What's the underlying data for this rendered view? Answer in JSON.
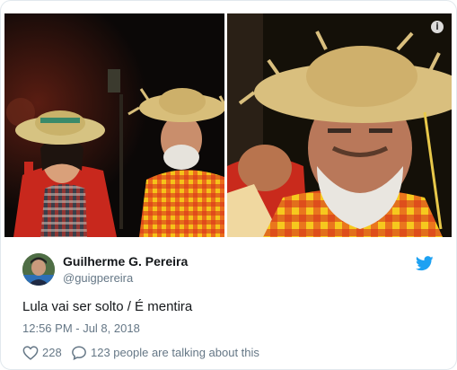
{
  "tweet": {
    "display_name": "Guilherme G. Pereira",
    "handle": "@guigpereira",
    "text": "Lula vai ser solto / É mentira",
    "timestamp": "12:56 PM - Jul 8, 2018",
    "like_count": "228",
    "talking_text": "123 people are talking about this"
  },
  "media": {
    "info_badge": "i"
  },
  "colors": {
    "twitter_blue": "#1da1f2",
    "text_primary": "#14171a",
    "text_secondary": "#657786",
    "border": "#e1e8ed"
  },
  "icons": [
    "info-icon",
    "twitter-bird-icon",
    "heart-icon",
    "reply-bubble-icon"
  ]
}
